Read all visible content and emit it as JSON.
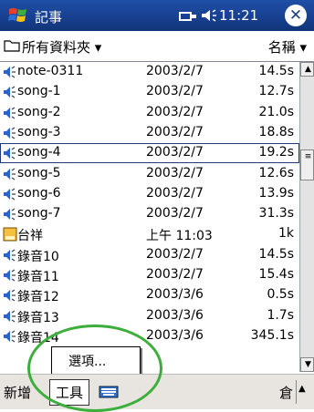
{
  "titlebar": {
    "app_title": "記事",
    "time": "11:21",
    "close_glyph": "✕"
  },
  "header": {
    "folder_label": "所有資料夾 ▾",
    "sort_label": "名稱 ▾"
  },
  "rows": [
    {
      "name": "note-0311",
      "date": "2003/2/7",
      "size": "14.5s",
      "icon": "speaker-icon"
    },
    {
      "name": "song-1",
      "date": "2003/2/7",
      "size": "12.7s",
      "icon": "speaker-icon"
    },
    {
      "name": "song-2",
      "date": "2003/2/7",
      "size": "21.0s",
      "icon": "speaker-icon"
    },
    {
      "name": "song-3",
      "date": "2003/2/7",
      "size": "18.8s",
      "icon": "speaker-icon"
    },
    {
      "name": "song-4",
      "date": "2003/2/7",
      "size": "19.2s",
      "icon": "speaker-icon"
    },
    {
      "name": "song-5",
      "date": "2003/2/7",
      "size": "12.6s",
      "icon": "speaker-icon"
    },
    {
      "name": "song-6",
      "date": "2003/2/7",
      "size": "13.9s",
      "icon": "speaker-icon"
    },
    {
      "name": "song-7",
      "date": "2003/2/7",
      "size": "31.3s",
      "icon": "speaker-icon"
    },
    {
      "name": "台祥",
      "date": "上午 11:03",
      "size": "1k",
      "icon": "note-icon"
    },
    {
      "name": "錄音10",
      "date": "2003/2/7",
      "size": "14.5s",
      "icon": "speaker-icon"
    },
    {
      "name": "錄音11",
      "date": "2003/2/7",
      "size": "15.4s",
      "icon": "speaker-icon"
    },
    {
      "name": "錄音12",
      "date": "2003/3/6",
      "size": "0.5s",
      "icon": "speaker-icon"
    },
    {
      "name": "錄音13",
      "date": "2003/3/6",
      "size": "1.7s",
      "icon": "speaker-icon"
    },
    {
      "name": "錄音14",
      "date": "2003/3/6",
      "size": "345.1s",
      "icon": "speaker-icon"
    }
  ],
  "popup": {
    "item": "選項..."
  },
  "cmdbar": {
    "new": "新增",
    "tools": "工具",
    "sip_char": "倉"
  },
  "colors": {
    "titlebar": "#173f8e",
    "annotation": "#3cae3c"
  }
}
